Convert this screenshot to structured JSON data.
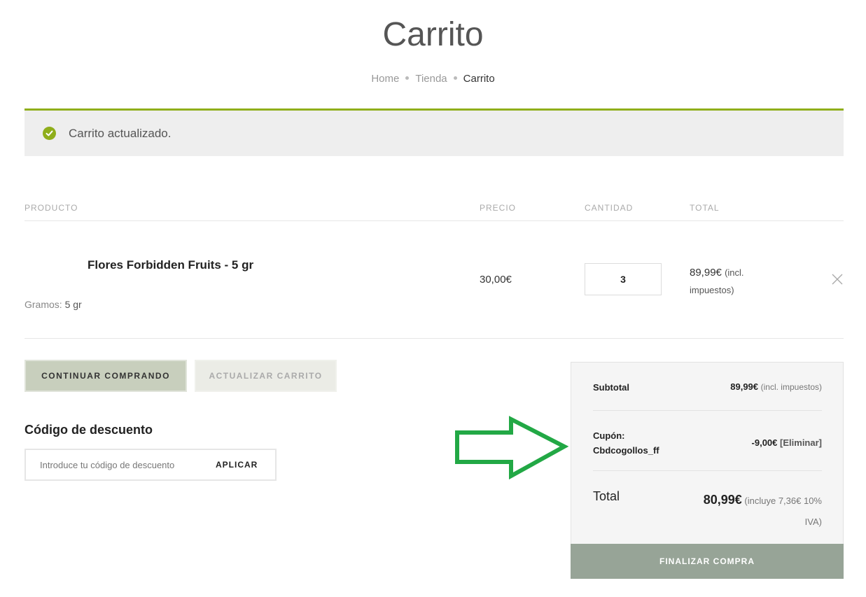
{
  "page": {
    "title": "Carrito",
    "breadcrumb": [
      "Home",
      "Tienda",
      "Carrito"
    ]
  },
  "notice": {
    "message": "Carrito actualizado.",
    "color": "#8fae1b"
  },
  "table": {
    "headers": [
      "PRODUCTO",
      "PRECIO",
      "CANTIDAD",
      "TOTAL"
    ],
    "items": [
      {
        "name": "Flores Forbidden Fruits - 5 gr",
        "meta_label": "Gramos:",
        "meta_value": "5 gr",
        "price": "30,00€",
        "quantity": "3",
        "total": "89,99€",
        "total_note": "(incl. impuestos)"
      }
    ]
  },
  "actions": {
    "continue_label": "CONTINUAR COMPRANDO",
    "update_label": "ACTUALIZAR CARRITO"
  },
  "coupon": {
    "title": "Código de descuento",
    "placeholder": "Introduce tu código de descuento",
    "apply_label": "APLICAR"
  },
  "totals": {
    "subtotal_label": "Subtotal",
    "subtotal_value": "89,99€",
    "subtotal_note": "(incl. impuestos)",
    "coupon_label": "Cupón:",
    "coupon_code": "Cbdcogollos_ff",
    "coupon_value": "-9,00€",
    "coupon_remove": "[Eliminar]",
    "total_label": "Total",
    "total_value": "80,99€",
    "total_note_line1": "(incluye 7,36€ 10%",
    "total_note_line2": "IVA)",
    "checkout_label": "FINALIZAR COMPRA"
  },
  "colors": {
    "accent_green": "#8fae1b",
    "annotation_arrow": "#22a845",
    "checkout_bg": "#97a497"
  },
  "icons": {
    "notice": "check-circle-icon",
    "remove": "close-icon",
    "annotation": "arrow-right-icon"
  }
}
